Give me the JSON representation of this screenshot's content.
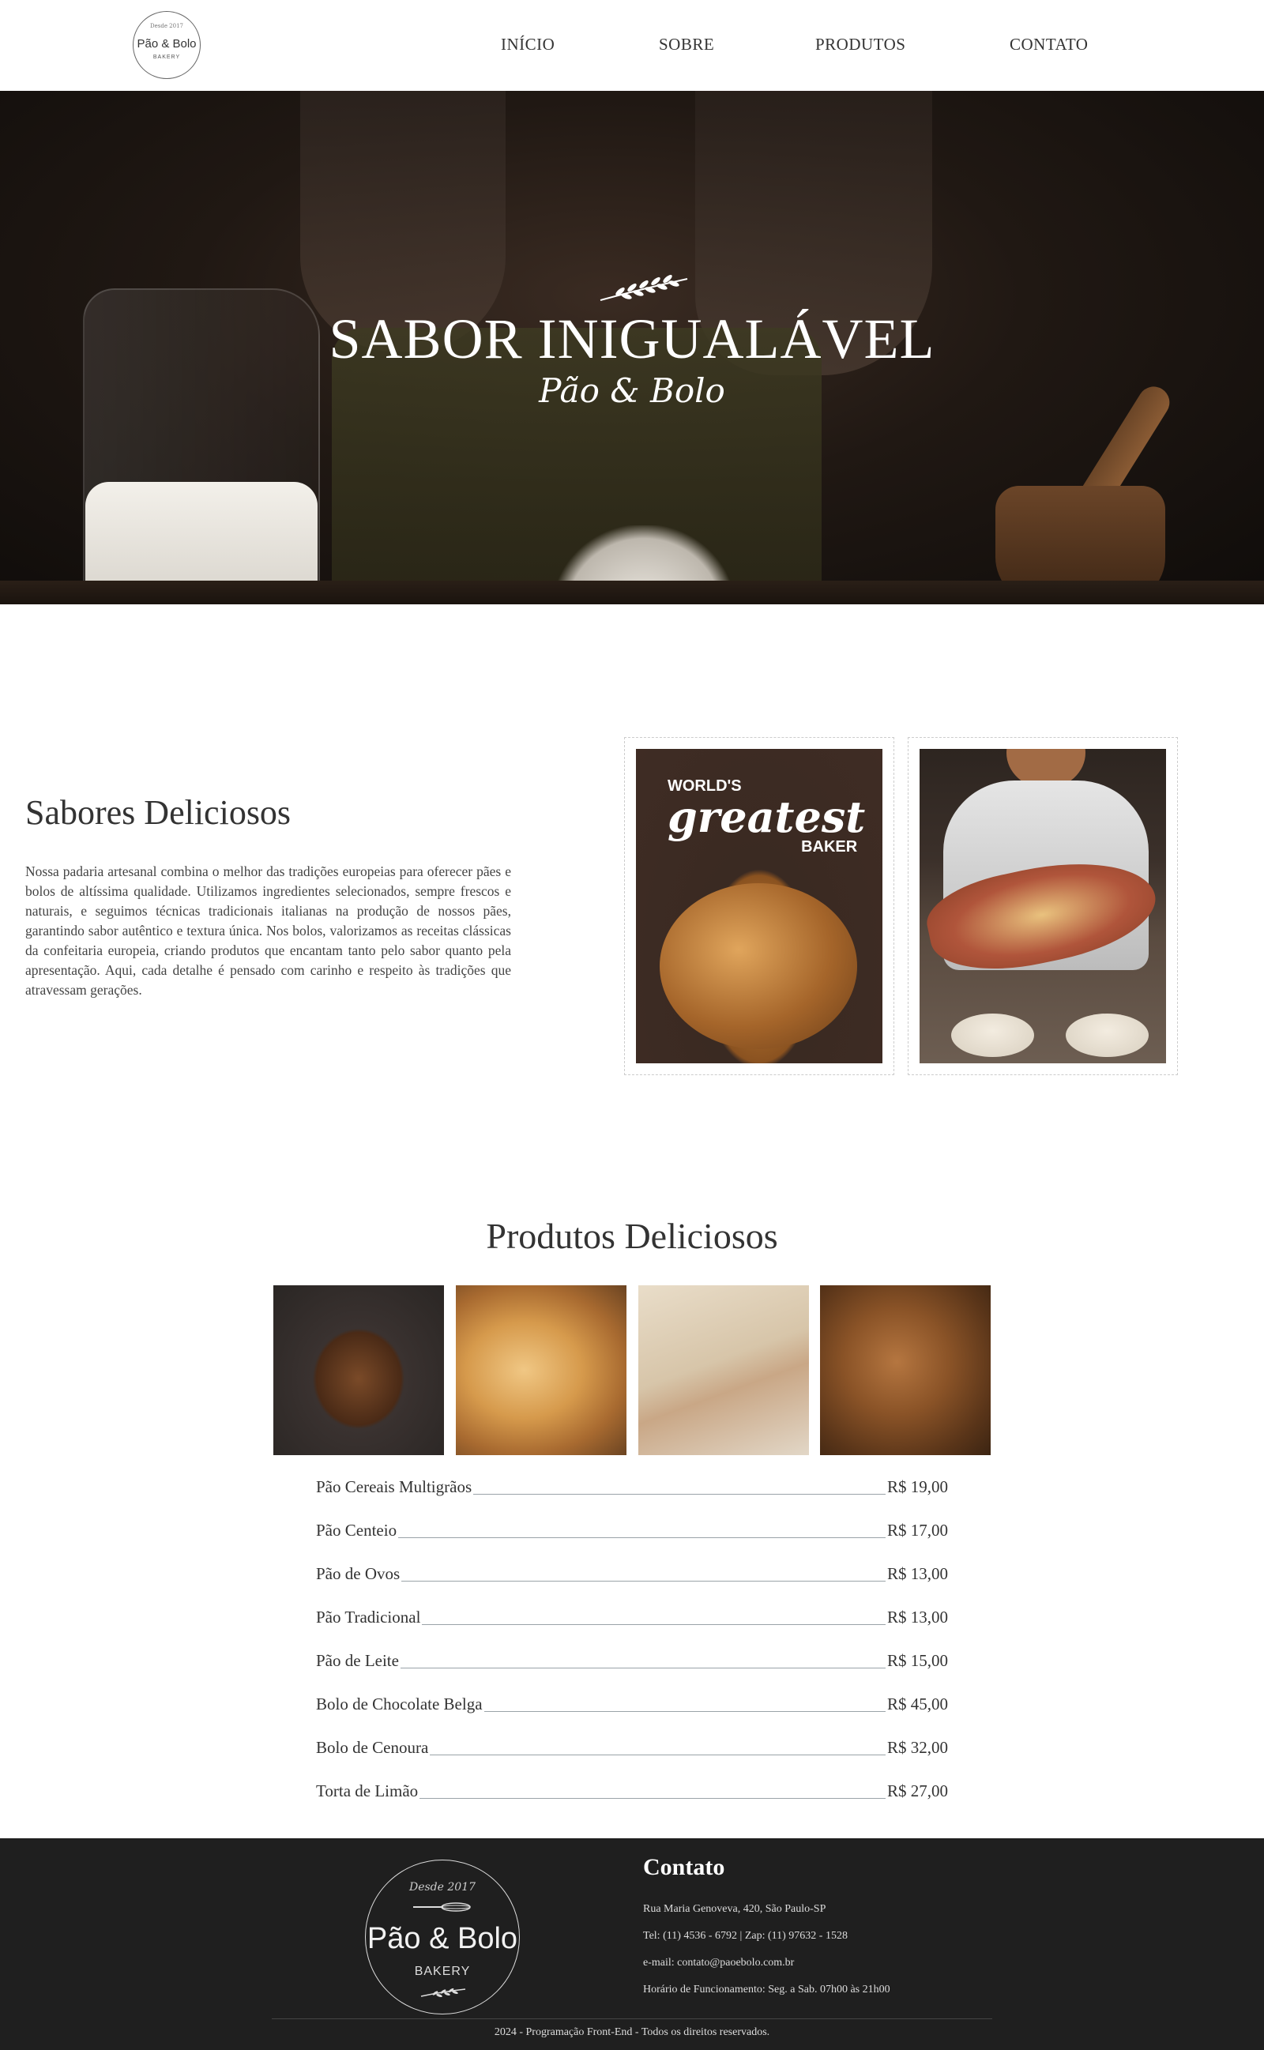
{
  "header": {
    "logo": {
      "top": "Desde 2017",
      "main": "Pão & Bolo",
      "sub": "BAKERY"
    },
    "nav": [
      "INÍCIO",
      "SOBRE",
      "PRODUTOS",
      "CONTATO"
    ]
  },
  "hero": {
    "title": "SABOR INIGUALÁVEL",
    "subtitle": "Pão & Bolo"
  },
  "about": {
    "title": "Sabores Deliciosos",
    "text": "Nossa padaria artesanal combina o melhor das tradições europeias para oferecer pães e bolos de altíssima qualidade. Utilizamos ingredientes selecionados, sempre frescos e naturais, e seguimos técnicas tradicionais italianas na produção de nossos pães, garantindo sabor autêntico e textura única. Nos bolos, valorizamos as receitas clássicas da confeitaria europeia, criando produtos que encantam tanto pelo sabor quanto pela apresentação. Aqui, cada detalhe é pensado com carinho e respeito às tradições que atravessam gerações.",
    "image1_caption": {
      "line1": "WORLD'S",
      "line2": "greatest",
      "line3": "BAKER"
    }
  },
  "products": {
    "title": "Produtos Deliciosos",
    "items": [
      {
        "name": "Pão Cereais Multigrãos",
        "price": "R$ 19,00"
      },
      {
        "name": "Pão Centeio",
        "price": "R$ 17,00"
      },
      {
        "name": "Pão de Ovos",
        "price": "R$ 13,00"
      },
      {
        "name": "Pão Tradicional",
        "price": "R$ 13,00"
      },
      {
        "name": "Pão de Leite",
        "price": "R$ 15,00"
      },
      {
        "name": "Bolo de Chocolate Belga",
        "price": "R$ 45,00"
      },
      {
        "name": "Bolo de Cenoura",
        "price": "R$ 32,00"
      },
      {
        "name": "Torta de Limão",
        "price": "R$ 27,00"
      }
    ]
  },
  "footer": {
    "logo": {
      "since": "Desde 2017",
      "main": "Pão & Bolo",
      "sub": "BAKERY"
    },
    "contact_title": "Contato",
    "address": "Rua Maria Genoveva, 420, São Paulo-SP",
    "phone": "Tel: (11) 4536 - 6792 | Zap: (11) 97632 - 1528",
    "email": "e-mail: contato@paoebolo.com.br",
    "hours": "Horário de Funcionamento: Seg. a Sab. 07h00 às 21h00",
    "copyright": "2024 - Programação Front-End - Todos os direitos reservados."
  }
}
